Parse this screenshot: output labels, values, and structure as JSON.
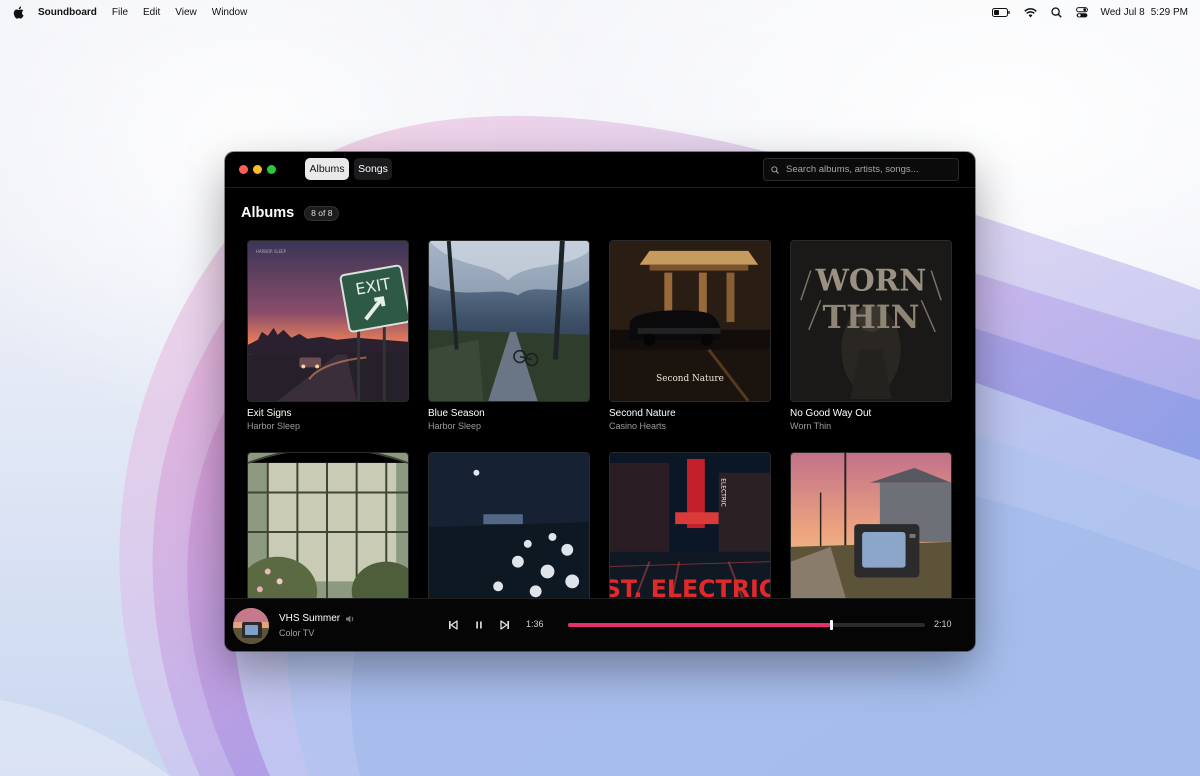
{
  "menubar": {
    "app_name": "Soundboard",
    "menus": [
      "File",
      "Edit",
      "View",
      "Window"
    ],
    "date": "Wed Jul 8",
    "time": "5:29 PM"
  },
  "window": {
    "tabs": [
      {
        "label": "Albums",
        "active": true
      },
      {
        "label": "Songs",
        "active": false
      }
    ],
    "search": {
      "placeholder": "Search albums, artists, songs..."
    },
    "heading": "Albums",
    "count_badge": "8 of 8",
    "albums": [
      {
        "title": "Exit Signs",
        "artist": "Harbor Sleep"
      },
      {
        "title": "Blue Season",
        "artist": "Harbor Sleep"
      },
      {
        "title": "Second Nature",
        "artist": "Casino Hearts"
      },
      {
        "title": "No Good Way Out",
        "artist": "Worn Thin"
      },
      {
        "title": "",
        "artist": ""
      },
      {
        "title": "",
        "artist": ""
      },
      {
        "title": "",
        "artist": ""
      },
      {
        "title": "",
        "artist": ""
      }
    ],
    "cover_text": {
      "exit_sign": "EXIT",
      "second_nature": "Second Nature",
      "worn_thin_1": "WORN",
      "worn_thin_2": "THIN",
      "st_electric": "ST. ELECTRIC",
      "marquee": "ELECTRIC"
    }
  },
  "player": {
    "title": "VHS Summer",
    "artist": "Color TV",
    "elapsed": "1:36",
    "total": "2:10",
    "progress": 0.738,
    "accent_color": "#e6306a",
    "controls": [
      "previous-icon",
      "pause-icon",
      "next-icon"
    ]
  }
}
